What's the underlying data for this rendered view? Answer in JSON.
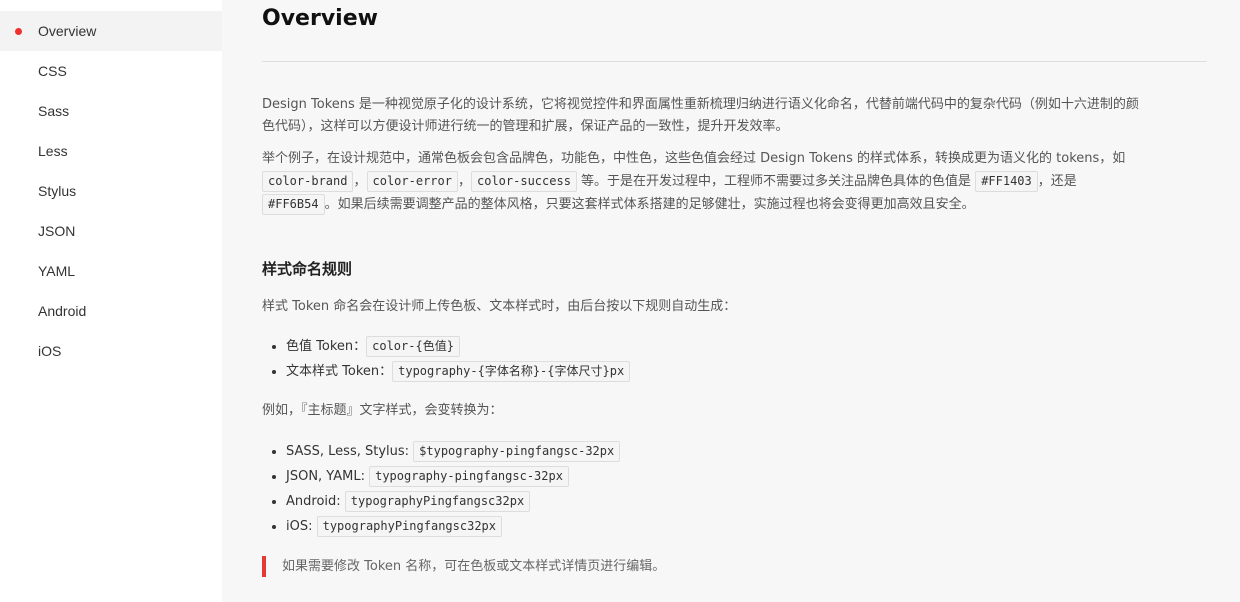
{
  "sidebar": {
    "items": [
      {
        "label": "Overview"
      },
      {
        "label": "CSS"
      },
      {
        "label": "Sass"
      },
      {
        "label": "Less"
      },
      {
        "label": "Stylus"
      },
      {
        "label": "JSON"
      },
      {
        "label": "YAML"
      },
      {
        "label": "Android"
      },
      {
        "label": "iOS"
      }
    ],
    "active_index": 0
  },
  "main": {
    "title": "Overview",
    "intro_line1": "Design Tokens 是一种视觉原子化的设计系统，它将视觉控件和界面属性重新梳理归纳进行语义化命名，代替前端代码中的复杂代码（例如十六进制的颜",
    "intro_line2": "色代码），这样可以方便设计师进行统一的管理和扩展，保证产品的一致性，提升开发效率。",
    "example": {
      "line1": "举个例子，在设计规范中，通常色板会包含品牌色，功能色，中性色，这些色值会经过 Design Tokens 的样式体系，转换成更为语义化的 tokens，如",
      "code_brand": "color-brand",
      "comma1": "，",
      "code_error": "color-error",
      "comma2": "，",
      "code_success": "color-success",
      "mid_text": " 等。于是在开发过程中，工程师不需要过多关注品牌色具体的色值是 ",
      "code_hex1": "#FF1403",
      "also_text": "，还是",
      "code_hex2": "#FF6B54",
      "end_text": "。如果后续需要调整产品的整体风格，只要这套样式体系搭建的足够健壮，实施过程也将会变得更加高效且安全。"
    },
    "naming": {
      "heading": "样式命名规则",
      "desc": "样式 Token 命名会在设计师上传色板、文本样式时，由后台按以下规则自动生成：",
      "rules": [
        {
          "label": "色值 Token：",
          "code": "color-{色值}"
        },
        {
          "label": "文本样式 Token：",
          "code": "typography-{字体名称}-{字体尺寸}px"
        }
      ],
      "example_intro": "例如，『主标题』文字样式，会变转换为：",
      "examples": [
        {
          "label": "SASS, Less, Stylus: ",
          "code": "$typography-pingfangsc-32px"
        },
        {
          "label": "JSON, YAML: ",
          "code": "typography-pingfangsc-32px"
        },
        {
          "label": "Android: ",
          "code": "typographyPingfangsc32px"
        },
        {
          "label": "iOS: ",
          "code": "typographyPingfangsc32px"
        }
      ]
    },
    "note": "如果需要修改 Token 名称，可在色板或文本样式详情页进行编辑。"
  },
  "colors": {
    "accent": "#f0302c",
    "note_bar": "#e53935",
    "sidebar_bg": "#ffffff",
    "page_bg": "#f7f7f7"
  }
}
